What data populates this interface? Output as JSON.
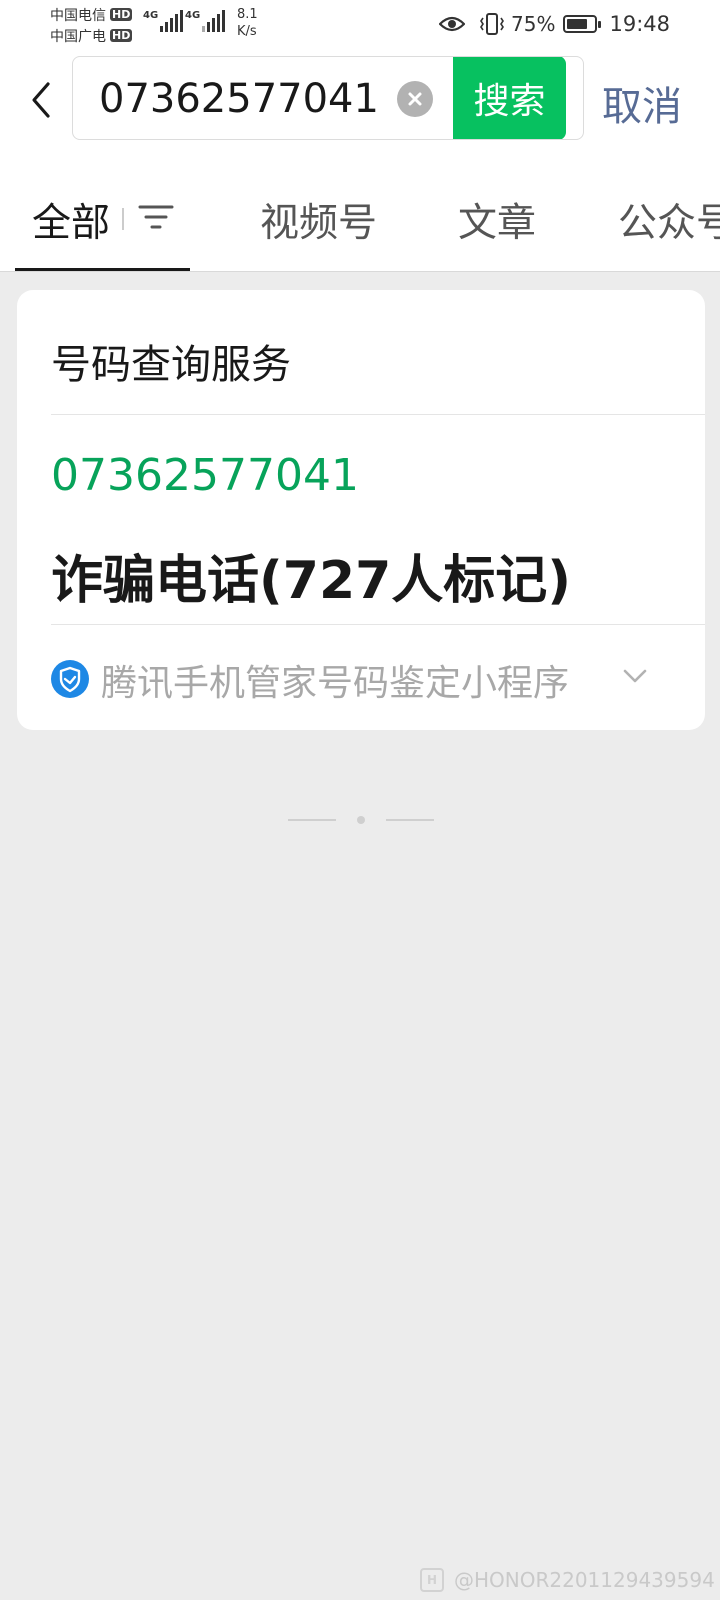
{
  "status_bar": {
    "carrier1": "中国电信",
    "carrier2": "中国广电",
    "hd": "HD",
    "net1": "4G",
    "net2": "4G",
    "speed_value": "8.1",
    "speed_unit": "K/s",
    "battery_percent": "75%",
    "battery_level": 0.75,
    "time": "19:48"
  },
  "search": {
    "query": "07362577041",
    "button_label": "搜索",
    "cancel_label": "取消"
  },
  "tabs": [
    {
      "label": "全部",
      "active": true
    },
    {
      "label": "视频号",
      "active": false
    },
    {
      "label": "文章",
      "active": false
    },
    {
      "label": "公众号",
      "active": false
    }
  ],
  "result_card": {
    "title": "号码查询服务",
    "phone_number": "07362577041",
    "result_text": "诈骗电话(727人标记)",
    "source_label": "腾讯手机管家号码鉴定小程序"
  },
  "watermark": {
    "logo_text": "H",
    "text": "@HONOR2201129439594"
  },
  "colors": {
    "accent_green": "#07c160",
    "number_green": "#07a35a",
    "link_blue": "#576b95",
    "shield_blue": "#1e88e5"
  }
}
